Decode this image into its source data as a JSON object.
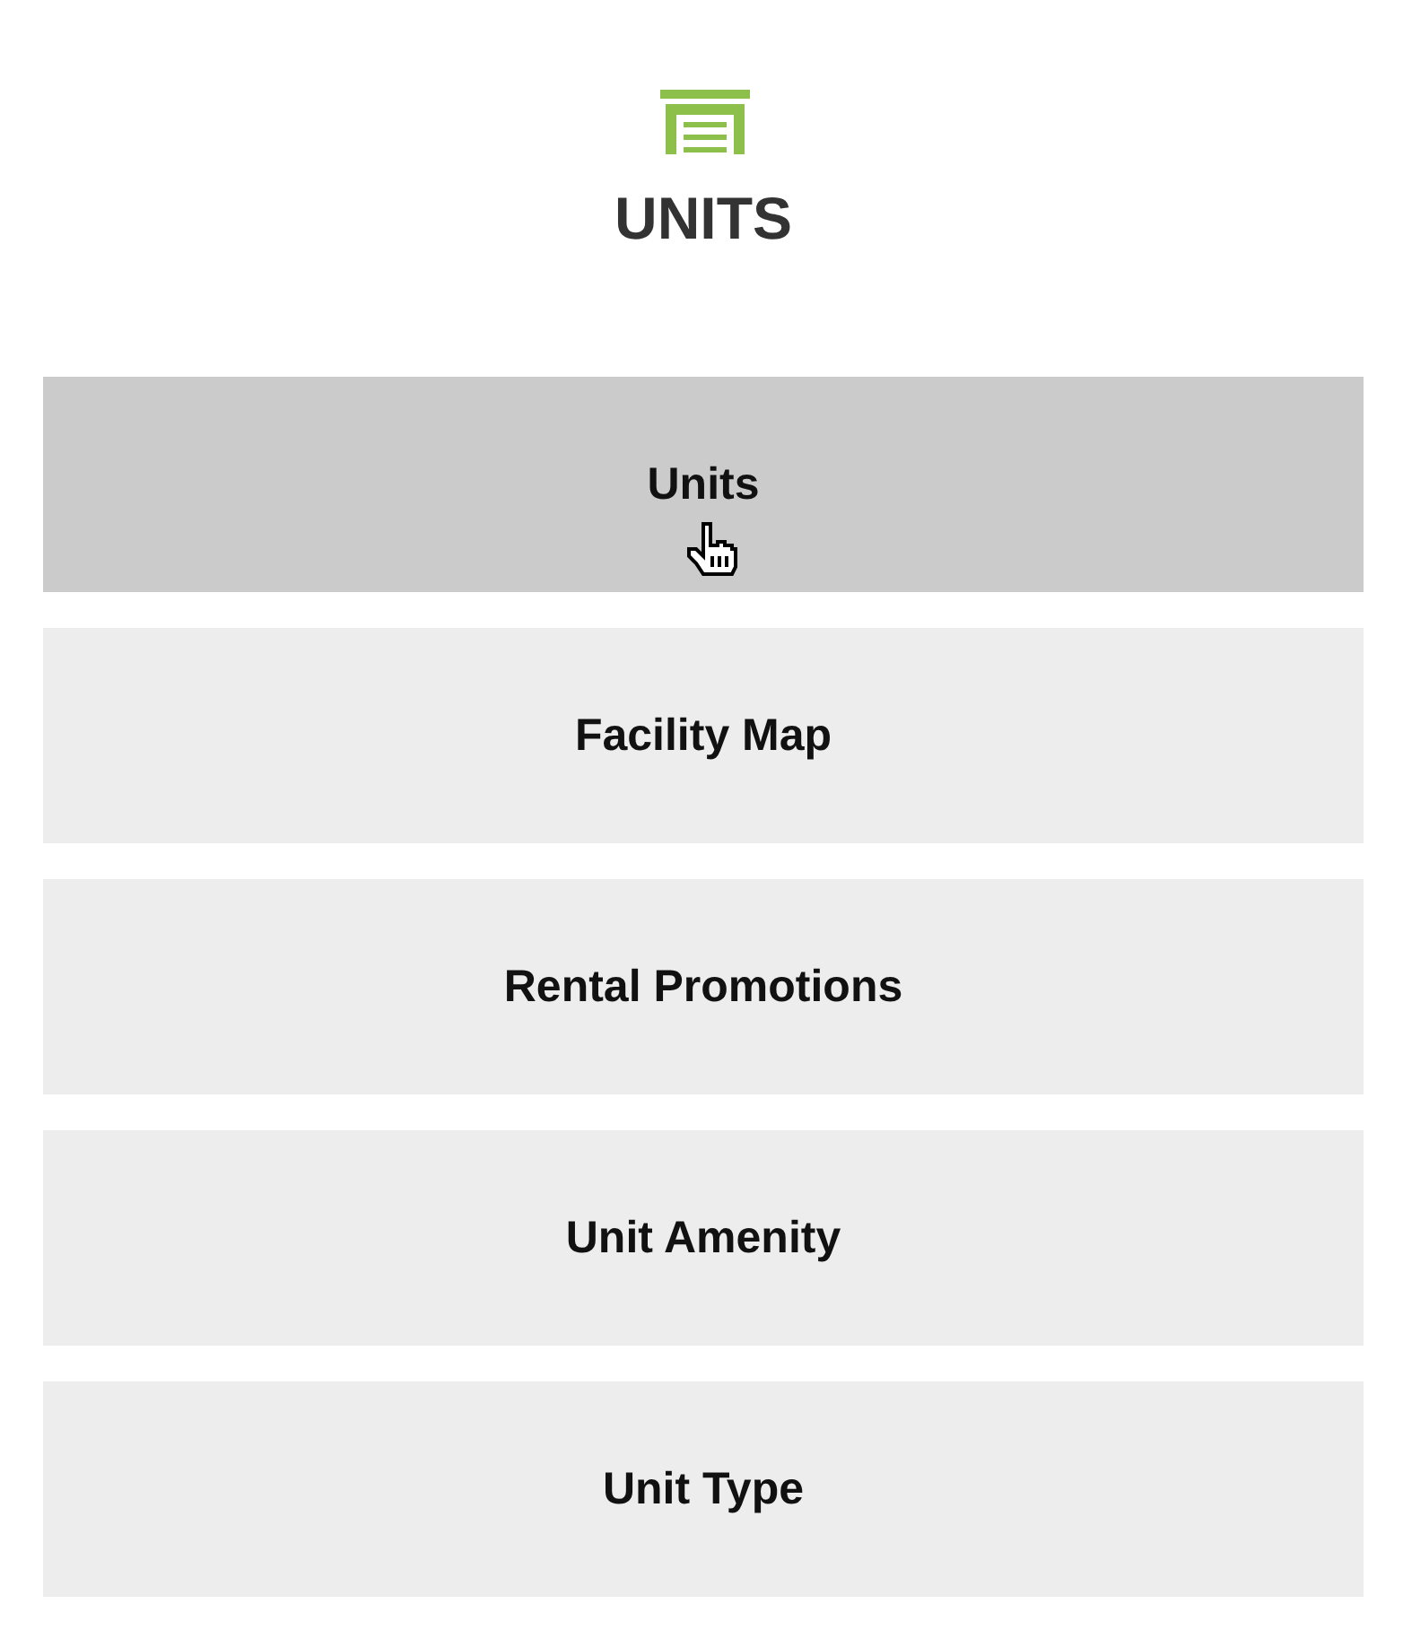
{
  "header": {
    "title": "UNITS"
  },
  "menu": [
    {
      "label": "Units",
      "selected": true
    },
    {
      "label": "Facility Map",
      "selected": false
    },
    {
      "label": "Rental Promotions",
      "selected": false
    },
    {
      "label": "Unit Amenity",
      "selected": false
    },
    {
      "label": "Unit Type",
      "selected": false
    }
  ]
}
